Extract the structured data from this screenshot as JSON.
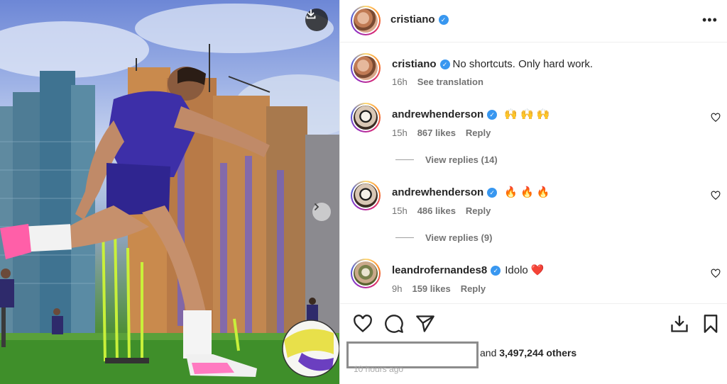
{
  "post": {
    "author": "cristiano",
    "caption": "No shortcuts. Only hard work.",
    "caption_time": "16h",
    "see_translation": "See translation"
  },
  "comments": [
    {
      "user": "andrewhenderson",
      "text": "🙌 🙌 🙌",
      "time": "15h",
      "likes": "867 likes",
      "reply": "Reply",
      "view_replies": "View replies (14)"
    },
    {
      "user": "andrewhenderson",
      "text": "🔥 🔥 🔥",
      "time": "15h",
      "likes": "486 likes",
      "reply": "Reply",
      "view_replies": "View replies (9)"
    },
    {
      "user": "leandrofernandes8",
      "text": "Idolo ❤️",
      "time": "9h",
      "likes": "159 likes",
      "reply": "Reply"
    }
  ],
  "likes": {
    "prefix": "and",
    "count": "3,497,244 others"
  },
  "time_ago": "10 hours ago",
  "icons": {
    "download": "download-icon",
    "next": "chevron-right-icon",
    "more": "more-horizontal-icon",
    "like": "heart-icon",
    "comment": "comment-icon",
    "share": "share-icon",
    "save_download": "download-tray-icon",
    "bookmark": "bookmark-icon",
    "verified": "verified-badge-icon"
  },
  "colors": {
    "verified": "#3897f0",
    "muted": "#737373",
    "heart_red": "#ed4956"
  }
}
